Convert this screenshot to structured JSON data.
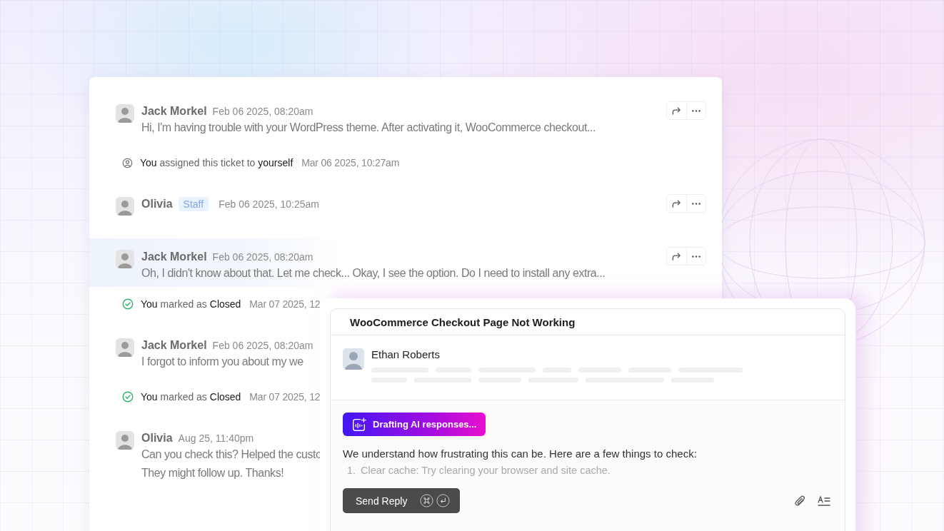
{
  "thread": [
    {
      "kind": "message",
      "author": "Jack Morkel",
      "time": "Feb 06 2025, 08:20am",
      "text": "Hi, I'm having trouble with your WordPress theme. After activating it, WooCommerce checkout...",
      "highlighted": false,
      "actions": true
    },
    {
      "kind": "assignment",
      "actor": "You",
      "action": "assigned this ticket to",
      "target": "yourself",
      "time": "Mar 06 2025, 10:27am"
    },
    {
      "kind": "message",
      "author": "Olivia",
      "badge": "Staff",
      "time": "Feb 06 2025, 10:25am",
      "highlighted": false,
      "actions": true
    },
    {
      "kind": "message",
      "author": "Jack Morkel",
      "time": "Feb 06 2025, 08:20am",
      "text": "Oh, I didn't know about that. Let me check... Okay, I see the option. Do I need to install any extra...",
      "highlighted": true,
      "actions": true
    },
    {
      "kind": "status_change",
      "actor": "You",
      "action": "marked as",
      "target": "Closed",
      "time": "Mar 07 2025, 12"
    },
    {
      "kind": "message",
      "author": "Jack Morkel",
      "time": "Feb 06 2025, 08:20am",
      "text": "I forgot to inform you about my we",
      "highlighted": false,
      "actions": false
    },
    {
      "kind": "status_change",
      "actor": "You",
      "action": "marked as",
      "target": "Closed",
      "time": "Mar 07 2025, 12"
    },
    {
      "kind": "message",
      "author": "Olivia",
      "time": "Aug 25, 11:40pm",
      "text": "Can you check this? Helped the custo",
      "text_2": "They might follow up. Thanks!",
      "highlighted": false,
      "actions": false
    }
  ],
  "reply_panel": {
    "title": "WooCommerce Checkout Page Not Working",
    "author": "Ethan Roberts",
    "ai_badge": "Drafting AI responses...",
    "draft": "We understand how frustrating this can be. Here are a few things to check:",
    "draft_items": [
      {
        "number": "1.",
        "text": "Clear cache: Try clearing your browser and site cache."
      }
    ],
    "send_button": "Send Reply"
  }
}
